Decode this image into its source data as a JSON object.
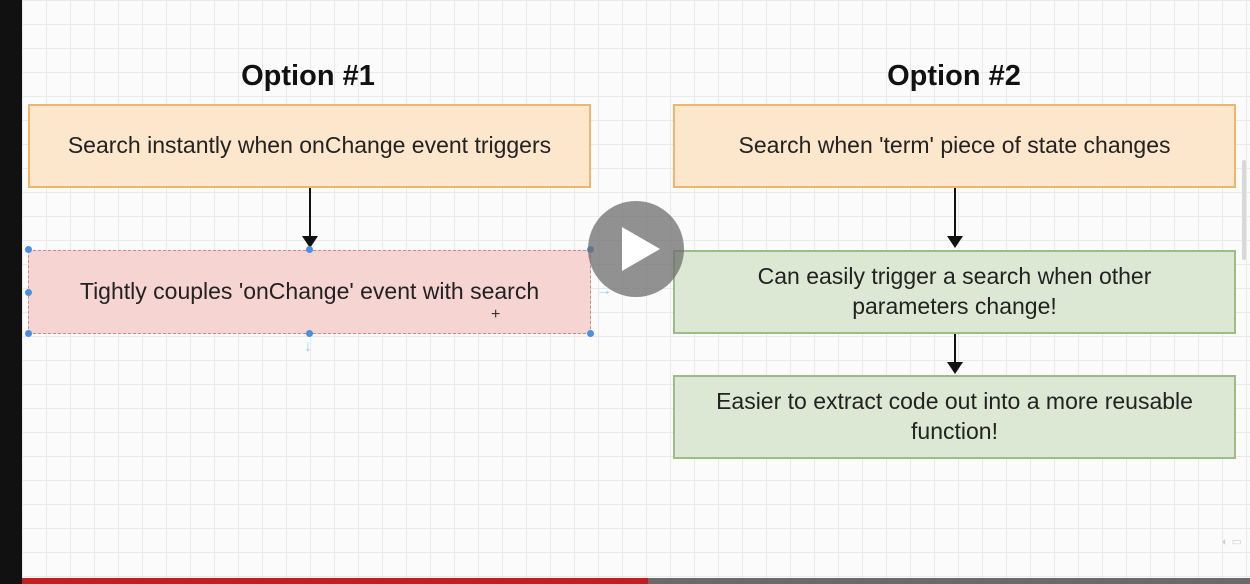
{
  "option1": {
    "title": "Option #1",
    "step1": "Search instantly when onChange event triggers",
    "step2": "Tightly couples 'onChange' event with search"
  },
  "option2": {
    "title": "Option #2",
    "step1": "Search when 'term' piece of state changes",
    "step2": "Can easily trigger a search when other parameters change!",
    "step3": "Easier to extract code out into a more reusable function!"
  },
  "player": {
    "progress": 0.51,
    "play_icon": "play-icon"
  },
  "colors": {
    "orange_fill": "#fce6cc",
    "red_fill": "#f6d4d2",
    "green_fill": "#dde8d4",
    "progress": "#c41d1d"
  }
}
